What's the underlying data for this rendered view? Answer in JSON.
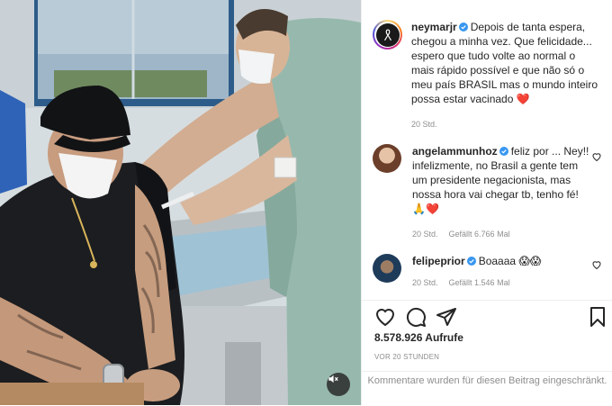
{
  "post": {
    "media": {
      "mute_icon": "speaker-muted-icon"
    },
    "caption": {
      "username": "neymarjr",
      "text": "Depois de tanta espera, chegou a minha vez. Que felicidade... espero que tudo volte ao normal o mais rápido possível e que não só o meu país BRASIL mas o mundo inteiro possa estar vacinado",
      "emoji": "❤️",
      "age": "20 Std."
    },
    "comments": [
      {
        "username": "angelammunhoz",
        "text": "feliz por ... Ney!! infelizmente, no Brasil a gente tem um presidente negacionista, mas nossa hora vai chegar tb, tenho fé!",
        "emoji": "🙏❤️",
        "age": "20 Std.",
        "likes": "Gefällt 6.766 Mal"
      },
      {
        "username": "felipeprior",
        "text": "Boaaaa",
        "emoji": "😱😱",
        "age": "20 Std.",
        "likes": "Gefällt 1.546 Mal"
      }
    ],
    "likes_count": "8.578.926 Aufrufe",
    "timestamp": "VOR 20 STUNDEN",
    "comments_restricted": "Kommentare wurden für diesen Beitrag eingeschränkt.",
    "colors": {
      "verified": "#3897f0",
      "heart": "#ed4956",
      "muted_text": "#8e8e8e"
    }
  }
}
